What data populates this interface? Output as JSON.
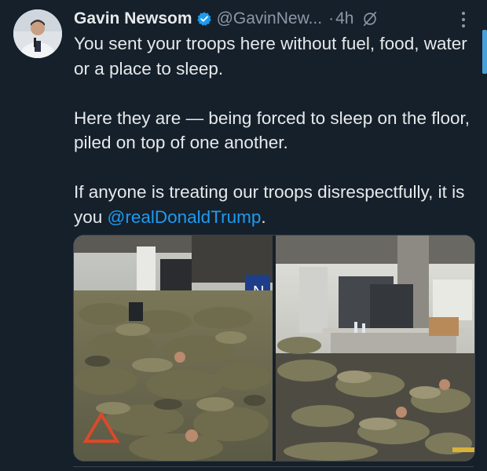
{
  "tweet": {
    "author_name": "Gavin Newsom",
    "author_handle": "@GavinNew...",
    "separator": "·",
    "timestamp": "4h",
    "text": {
      "line1": "You sent your troops here without fuel, food, water or a place to sleep.",
      "line2": "Here they are — being forced to sleep on the floor, piled on top of one another.",
      "line3_prefix": "If anyone is treating our troops disrespectfully, it is you ",
      "mention": "@realDonaldTrump",
      "line3_suffix": "."
    },
    "photo_count": 2
  },
  "icons": {
    "verified": "verified-badge-icon",
    "grok": "grok-icon",
    "more": "more-options-icon"
  },
  "colors": {
    "background": "#15202b",
    "text": "#e7e9ea",
    "muted": "#8b98a5",
    "link": "#1d9bf0"
  }
}
